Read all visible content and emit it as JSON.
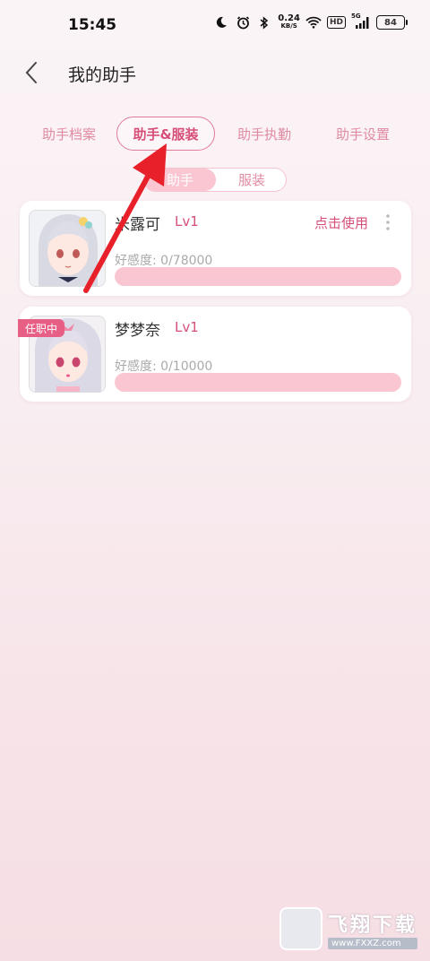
{
  "status_bar": {
    "time": "15:45",
    "net_speed_value": "0.24",
    "net_speed_unit": "KB/S",
    "hd_label": "HD",
    "network_label": "5G",
    "battery": "84",
    "icons": [
      "moon-icon",
      "alarm-icon",
      "bluetooth-icon",
      "wifi-icon",
      "signal-icon"
    ]
  },
  "header": {
    "title": "我的助手",
    "back_icon": "chevron-left-icon"
  },
  "tabs": [
    {
      "label": "助手档案",
      "active": false
    },
    {
      "label": "助手&服装",
      "active": true
    },
    {
      "label": "助手执勤",
      "active": false
    },
    {
      "label": "助手设置",
      "active": false
    }
  ],
  "segment": {
    "items": [
      {
        "label": "助手",
        "active": true
      },
      {
        "label": "服装",
        "active": false
      }
    ]
  },
  "assistants": [
    {
      "name": "米露可",
      "level": "Lv1",
      "affinity_label": "好感度:",
      "affinity_value": "0/78000",
      "affinity_fraction": 0,
      "action": "点击使用",
      "badge": ""
    },
    {
      "name": "梦梦奈",
      "level": "Lv1",
      "affinity_label": "好感度:",
      "affinity_value": "0/10000",
      "affinity_fraction": 0,
      "action": "",
      "badge": "任职中"
    }
  ],
  "colors": {
    "accent": "#d64f78",
    "tab_text": "#e08aa2",
    "bar_bg": "#f9c6d2",
    "annotation_arrow": "#e8202a"
  },
  "watermark": {
    "name": "飞翔下载",
    "url": "www.FXXZ.com"
  }
}
